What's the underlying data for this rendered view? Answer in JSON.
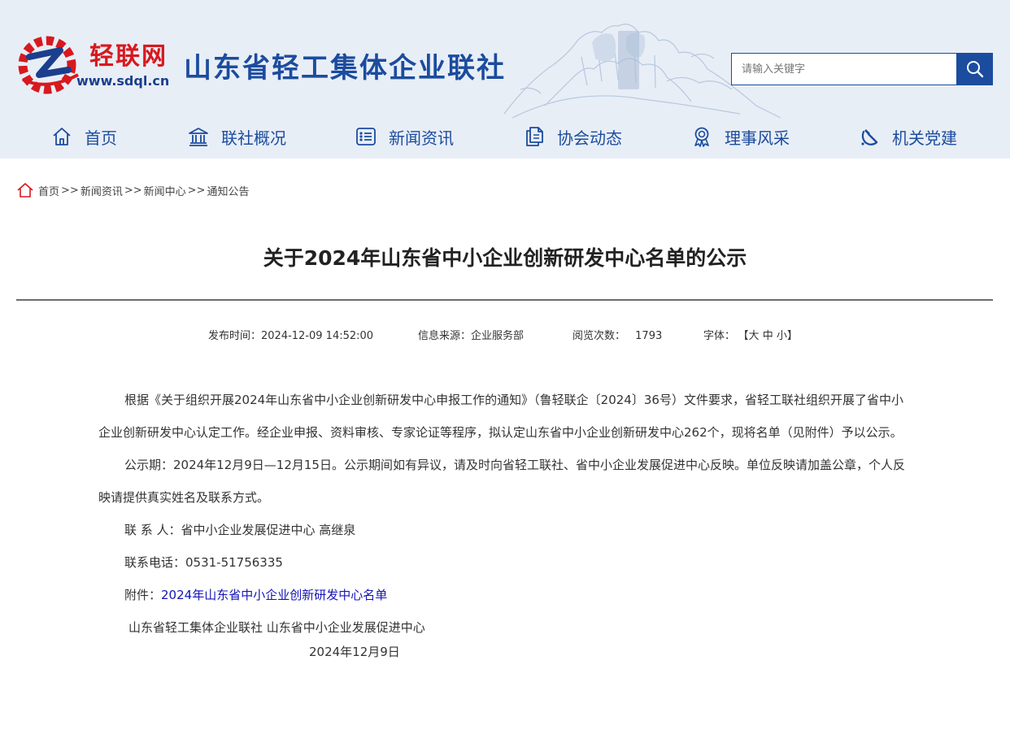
{
  "header": {
    "logo_cn": "轻联网",
    "logo_url": "www.sdql.cn",
    "site_title": "山东省轻工集体企业联社",
    "colors": {
      "brand_blue": "#1b4c9e",
      "logo_red": "#d7191f",
      "header_bg": "#e8eef6"
    }
  },
  "search": {
    "placeholder": "请输入关键字",
    "button_icon": "search-icon"
  },
  "nav": {
    "items": [
      {
        "label": "首页",
        "icon": "home-icon"
      },
      {
        "label": "联社概况",
        "icon": "institution-icon"
      },
      {
        "label": "新闻资讯",
        "icon": "news-list-icon"
      },
      {
        "label": "协会动态",
        "icon": "document-copy-icon"
      },
      {
        "label": "理事风采",
        "icon": "award-badge-icon"
      },
      {
        "label": "机关党建",
        "icon": "hammer-sickle-icon"
      }
    ]
  },
  "breadcrumb": {
    "items": [
      "首页",
      "新闻资讯",
      "新闻中心",
      "通知公告"
    ],
    "separator": ">>"
  },
  "article": {
    "title": "关于2024年山东省中小企业创新研发中心名单的公示",
    "meta": {
      "publish_time": "发布时间：2024-12-09 14:52:00",
      "source": "信息来源：企业服务部",
      "views_label": "阅览次数：",
      "views": "1793",
      "font_label": "字体：",
      "font_open": "【",
      "font_large": "大",
      "font_medium": "中",
      "font_small": "小",
      "font_close": "】"
    },
    "paragraph1": "根据《关于组织开展2024年山东省中小企业创新研发中心申报工作的通知》（鲁轻联企〔2024〕36号）文件要求，省轻工联社组织开展了省中小企业创新研发中心认定工作。经企业申报、资料审核、专家论证等程序，拟认定山东省中小企业创新研发中心262个，现将名单（见附件）予以公示。",
    "paragraph2": "公示期：2024年12月9日—12月15日。公示期间如有异议，请及时向省轻工联社、省中小企业发展促进中心反映。单位反映请加盖公章，个人反映请提供真实姓名及联系方式。",
    "contact": "联 系 人：省中小企业发展促进中心 高继泉",
    "phone": "联系电话：0531-51756335",
    "attachment_label": "附件：",
    "attachment_link": "2024年山东省中小企业创新研发中心名单",
    "signature": "山东省轻工集体企业联社  山东省中小企业发展促进中心",
    "date": "2024年12月9日"
  }
}
